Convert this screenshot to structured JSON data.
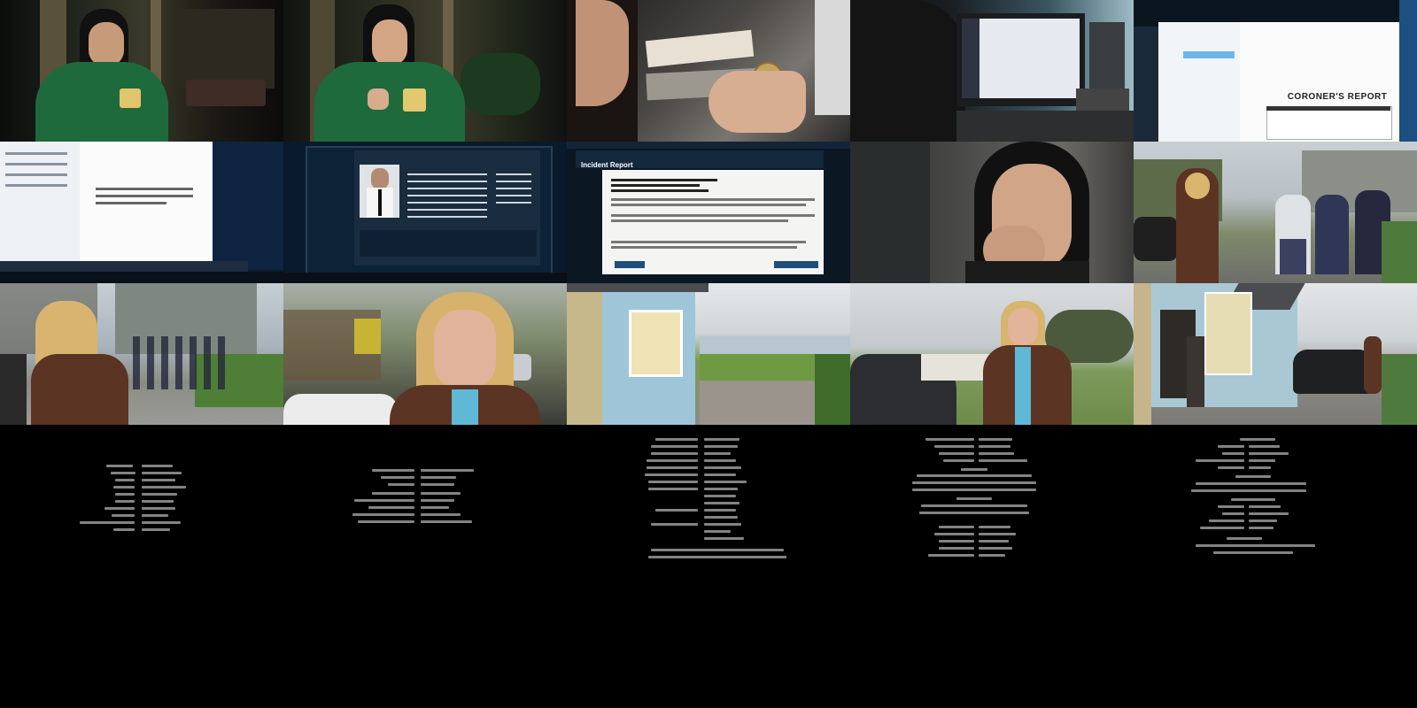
{
  "frames": [
    {
      "name": "frame-girl-phone-night",
      "description": ""
    },
    {
      "name": "frame-girl-phone-lit",
      "description": ""
    },
    {
      "name": "frame-coin-desk",
      "description": ""
    },
    {
      "name": "frame-computer-monitor",
      "description": ""
    },
    {
      "name": "frame-coroners-report-screen",
      "title": "CORONER'S REPORT"
    },
    {
      "name": "frame-email-screen",
      "description": ""
    },
    {
      "name": "frame-police-record-screen",
      "description": ""
    },
    {
      "name": "frame-incident-report-screen",
      "title": "Incident Report"
    },
    {
      "name": "frame-woman-hand-mouth",
      "description": ""
    },
    {
      "name": "frame-schoolgirls-walking",
      "description": ""
    },
    {
      "name": "frame-woman-school-path",
      "description": ""
    },
    {
      "name": "frame-woman-closeup",
      "description": ""
    },
    {
      "name": "frame-cottage-seaview",
      "description": ""
    },
    {
      "name": "frame-woman-by-car",
      "description": ""
    },
    {
      "name": "frame-cottage-car",
      "description": ""
    }
  ],
  "colors": {
    "background": "#000000",
    "credit_text": "#9a9a9a",
    "screen_blue": "#1e4f7a",
    "coat_brown": "#5b3424"
  }
}
